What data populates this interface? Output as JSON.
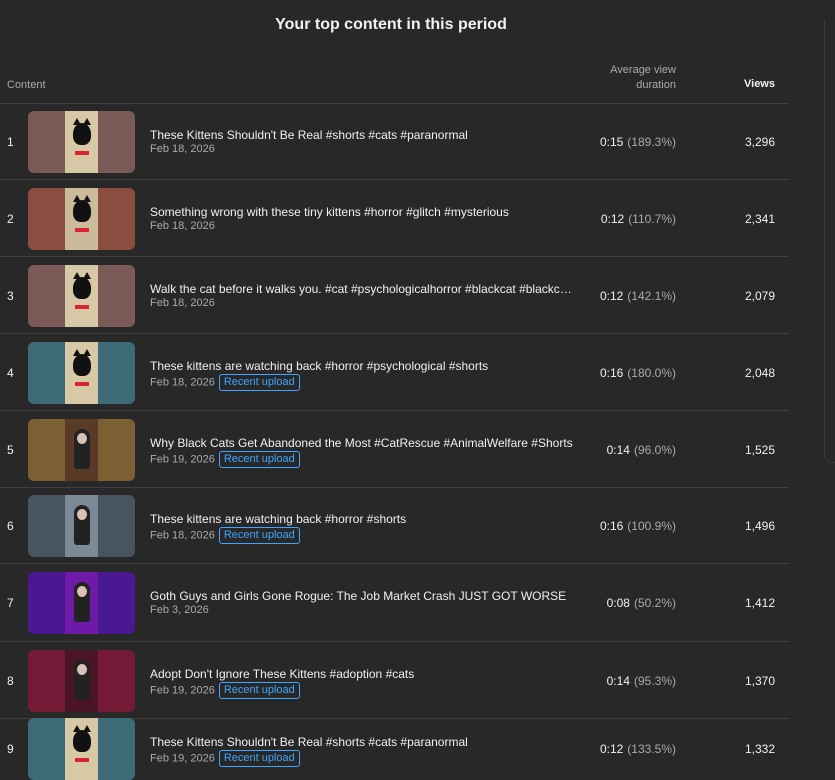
{
  "panel": {
    "title": "Your top content in this period"
  },
  "columns": {
    "content": "Content",
    "avg_line1": "Average view",
    "avg_line2": "duration",
    "views": "Views"
  },
  "rows": [
    {
      "rank": "1",
      "title": "These Kittens Shouldn't Be Real #shorts #cats #paranormal",
      "date": "Feb 18, 2026",
      "badge": "",
      "avg": "0:15",
      "pct": "(189.3%)",
      "views": "3,296",
      "thumb_bg": "#7a5a57",
      "thumb_inner": "#d8c9a6",
      "kind": "cat"
    },
    {
      "rank": "2",
      "title": "Something wrong with these tiny kittens #horror #glitch #mysterious",
      "date": "Feb 18, 2026",
      "badge": "",
      "avg": "0:12",
      "pct": "(110.7%)",
      "views": "2,341",
      "thumb_bg": "#8a4d3f",
      "thumb_inner": "#cbbb9a",
      "kind": "cat"
    },
    {
      "rank": "3",
      "title": "Walk the cat before it walks you. #cat #psychologicalhorror #blackcat #blackcat...",
      "date": "Feb 18, 2026",
      "badge": "",
      "avg": "0:12",
      "pct": "(142.1%)",
      "views": "2,079",
      "thumb_bg": "#7a5a57",
      "thumb_inner": "#d8c9a6",
      "kind": "cat"
    },
    {
      "rank": "4",
      "title": "These kittens are watching back #horror #psychological #shorts",
      "date": "Feb 18, 2026",
      "badge": "Recent upload",
      "avg": "0:16",
      "pct": "(180.0%)",
      "views": "2,048",
      "thumb_bg": "#3f6a78",
      "thumb_inner": "#d8c9a6",
      "kind": "cat"
    },
    {
      "rank": "5",
      "title": "Why Black Cats Get Abandoned the Most #CatRescue #AnimalWelfare #Shorts",
      "date": "Feb 19, 2026",
      "badge": "Recent upload",
      "avg": "0:14",
      "pct": "(96.0%)",
      "views": "1,525",
      "thumb_bg": "#7d5f34",
      "thumb_inner": "#5a3a26",
      "kind": "person"
    },
    {
      "rank": "6",
      "title": "These kittens are watching back #horror #shorts",
      "date": "Feb 18, 2026",
      "badge": "Recent upload",
      "avg": "0:16",
      "pct": "(100.9%)",
      "views": "1,496",
      "thumb_bg": "#48545e",
      "thumb_inner": "#7b8a96",
      "kind": "person"
    },
    {
      "rank": "7",
      "title": "Goth Guys and Girls Gone Rogue: The Job Market Crash JUST GOT WORSE",
      "date": "Feb 3, 2026",
      "badge": "",
      "avg": "0:08",
      "pct": "(50.2%)",
      "views": "1,412",
      "thumb_bg": "#4a1890",
      "thumb_inner": "#6d1aa8",
      "kind": "person"
    },
    {
      "rank": "8",
      "title": "Adopt Don't Ignore These Kittens #adoption #cats",
      "date": "Feb 19, 2026",
      "badge": "Recent upload",
      "avg": "0:14",
      "pct": "(95.3%)",
      "views": "1,370",
      "thumb_bg": "#741a36",
      "thumb_inner": "#4a1524",
      "kind": "person"
    },
    {
      "rank": "9",
      "title": "These Kittens Shouldn't Be Real #shorts #cats #paranormal",
      "date": "Feb 19, 2026",
      "badge": "Recent upload",
      "avg": "0:12",
      "pct": "(133.5%)",
      "views": "1,332",
      "thumb_bg": "#3f6a78",
      "thumb_inner": "#d8c9a6",
      "kind": "cat"
    }
  ]
}
